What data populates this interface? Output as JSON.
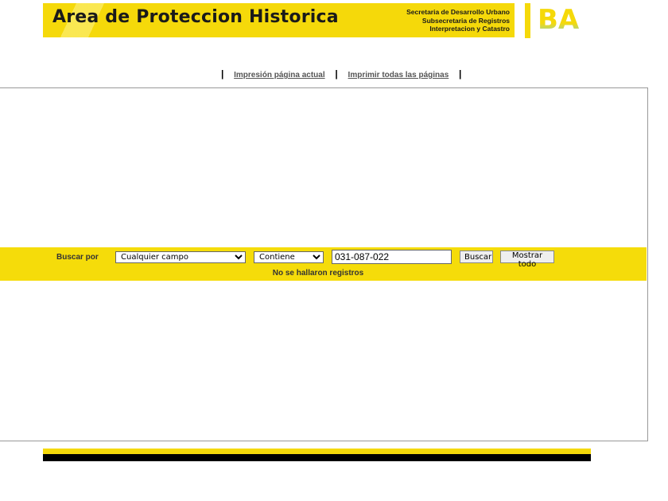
{
  "header": {
    "title": "Area de Proteccion Historica",
    "subtitle_lines": [
      "Secretaria de Desarrollo Urbano",
      "Subsecretaria de Registros",
      "Interpretacion y Catastro"
    ],
    "logo_text": "BA"
  },
  "print_links": {
    "current_page": "Impresión página actual",
    "all_pages": "Imprimir todas las páginas",
    "separator": "|"
  },
  "search": {
    "label": "Buscar por",
    "field_selected": "Cualquier campo",
    "operator_selected": "Contiene",
    "query_value": "031-087-022",
    "search_button": "Buscar",
    "show_all_button": "Mostrar todo",
    "status": "No se hallaron registros"
  },
  "colors": {
    "brand_yellow": "#f5d90a",
    "footer_black": "#000000"
  }
}
